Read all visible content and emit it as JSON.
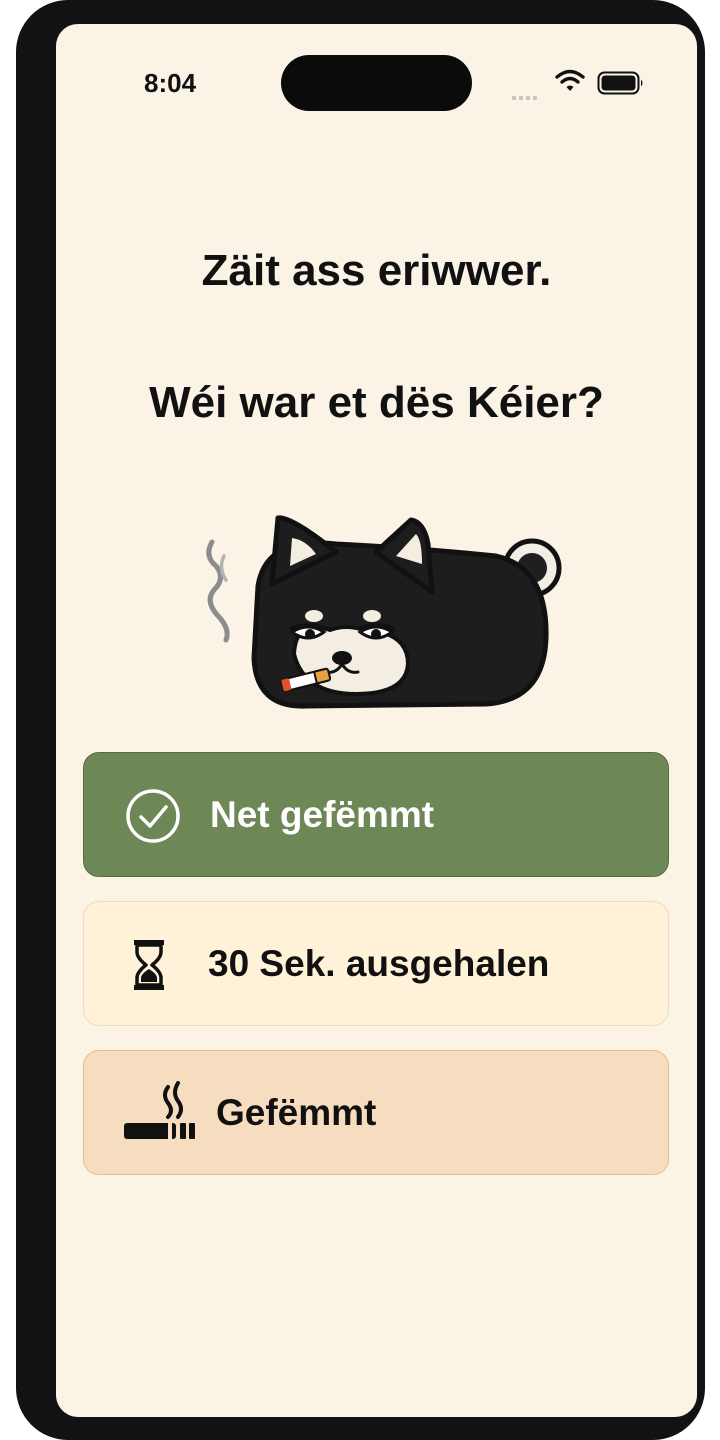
{
  "status_bar": {
    "time": "8:04"
  },
  "heading": {
    "line1": "Zäit ass eriwwer.",
    "line2": "Wéi war et dës Kéier?"
  },
  "mascot": {
    "description_icon": "smoking-dog-icon"
  },
  "options": [
    {
      "label": "Net gefëmmt",
      "icon": "check-circle-icon",
      "color": "#6E8757"
    },
    {
      "label": "30 Sek. ausgehalen",
      "icon": "hourglass-icon",
      "color": "#FFF2D9"
    },
    {
      "label": "Gefëmmt",
      "icon": "cigarette-icon",
      "color": "#F7DDBF"
    }
  ]
}
